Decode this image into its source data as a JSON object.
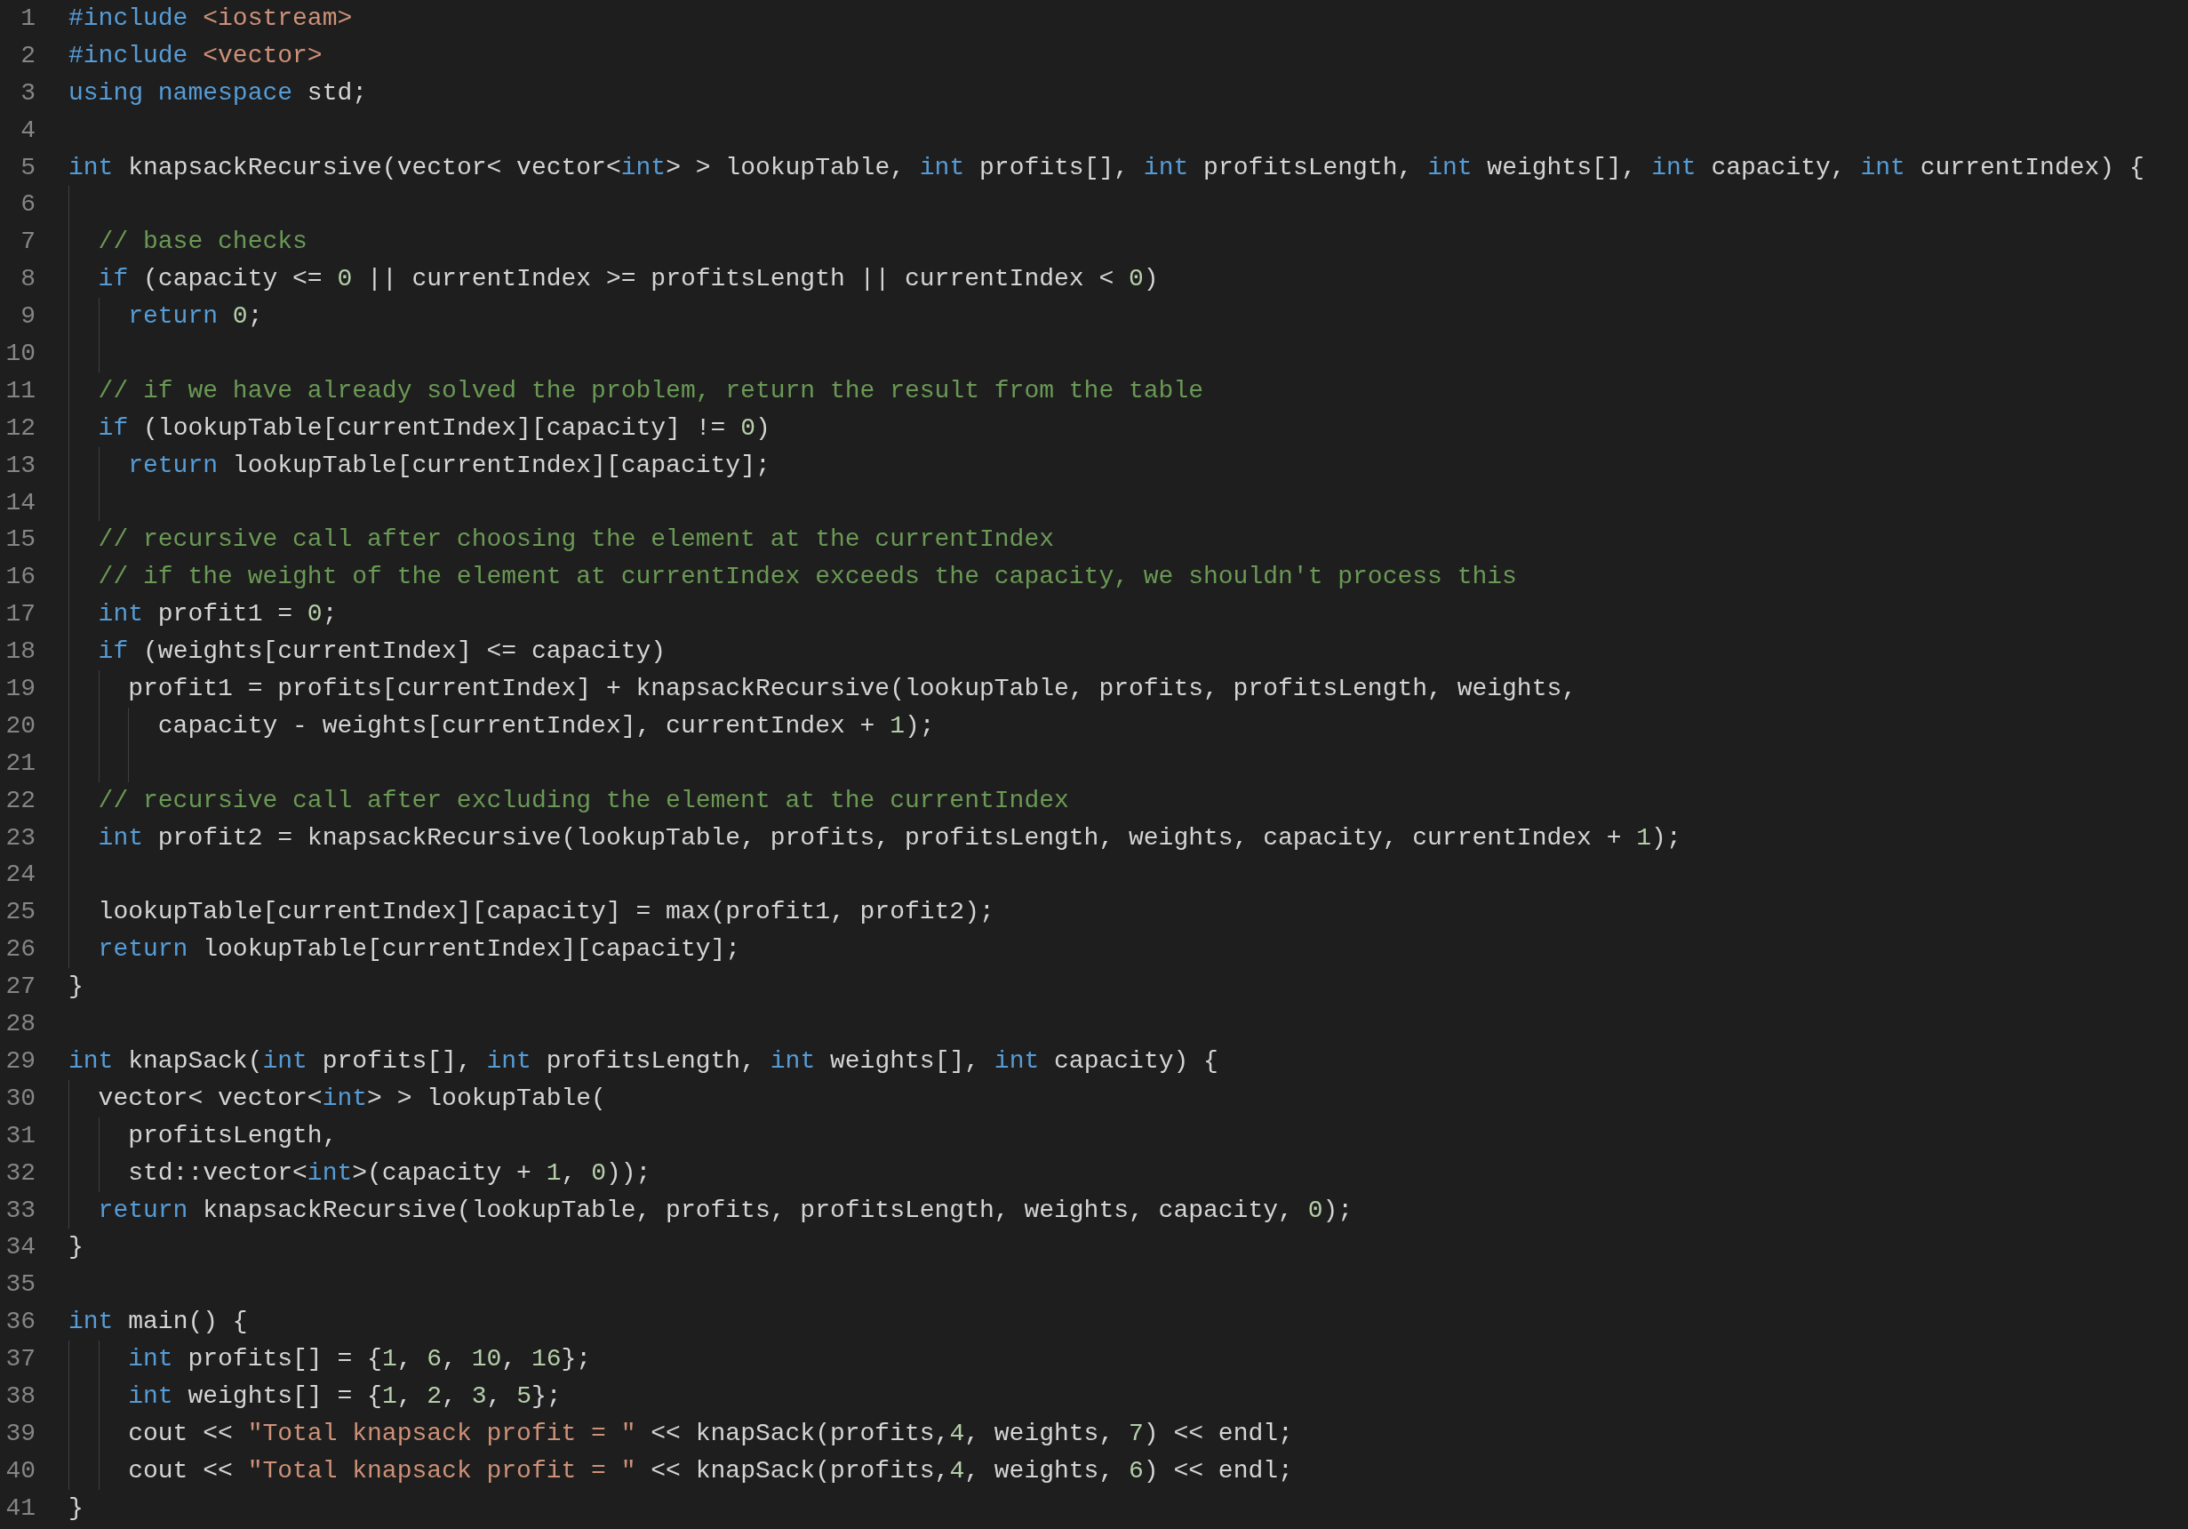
{
  "editor": {
    "lines": [
      {
        "number": "1",
        "tokens": [
          {
            "kind": "keyword",
            "text": "#include "
          },
          {
            "kind": "string",
            "text": "<iostream>"
          }
        ]
      },
      {
        "number": "2",
        "tokens": [
          {
            "kind": "keyword",
            "text": "#include "
          },
          {
            "kind": "string",
            "text": "<vector>"
          }
        ]
      },
      {
        "number": "3",
        "tokens": [
          {
            "kind": "keyword",
            "text": "using namespace"
          },
          {
            "kind": "plain",
            "text": " std;"
          }
        ]
      },
      {
        "number": "4"
      },
      {
        "number": "5",
        "tokens": [
          {
            "kind": "keyword",
            "text": "int"
          },
          {
            "kind": "plain",
            "text": " knapsackRecursive(vector< vector<"
          },
          {
            "kind": "keyword",
            "text": "int"
          },
          {
            "kind": "plain",
            "text": "> > lookupTable, "
          },
          {
            "kind": "keyword",
            "text": "int"
          },
          {
            "kind": "plain",
            "text": " profits[], "
          },
          {
            "kind": "keyword",
            "text": "int"
          },
          {
            "kind": "plain",
            "text": " profitsLength, "
          },
          {
            "kind": "keyword",
            "text": "int"
          },
          {
            "kind": "plain",
            "text": " weights[], "
          },
          {
            "kind": "keyword",
            "text": "int"
          },
          {
            "kind": "plain",
            "text": " capacity, "
          },
          {
            "kind": "keyword",
            "text": "int"
          },
          {
            "kind": "plain",
            "text": " currentIndex) {"
          }
        ]
      },
      {
        "number": "6"
      },
      {
        "number": "7",
        "tokens": [
          {
            "kind": "comment",
            "text": "  // base checks"
          }
        ]
      },
      {
        "number": "8",
        "tokens": [
          {
            "kind": "keyword",
            "text": "  if"
          },
          {
            "kind": "plain",
            "text": " (capacity <= "
          },
          {
            "kind": "number",
            "text": "0"
          },
          {
            "kind": "plain",
            "text": " || currentIndex >= profitsLength || currentIndex < "
          },
          {
            "kind": "number",
            "text": "0"
          },
          {
            "kind": "plain",
            "text": ")"
          }
        ]
      },
      {
        "number": "9",
        "tokens": [
          {
            "kind": "keyword",
            "text": "    return "
          },
          {
            "kind": "number",
            "text": "0"
          },
          {
            "kind": "plain",
            "text": ";"
          }
        ]
      },
      {
        "number": "10"
      },
      {
        "number": "11",
        "tokens": [
          {
            "kind": "comment",
            "text": "  // if we have already solved the problem, return the result from the table"
          }
        ]
      },
      {
        "number": "12",
        "tokens": [
          {
            "kind": "keyword",
            "text": "  if"
          },
          {
            "kind": "plain",
            "text": " (lookupTable[currentIndex][capacity] != "
          },
          {
            "kind": "number",
            "text": "0"
          },
          {
            "kind": "plain",
            "text": ")"
          }
        ]
      },
      {
        "number": "13",
        "tokens": [
          {
            "kind": "keyword",
            "text": "    return"
          },
          {
            "kind": "plain",
            "text": " lookupTable[currentIndex][capacity];"
          }
        ]
      },
      {
        "number": "14"
      },
      {
        "number": "15",
        "tokens": [
          {
            "kind": "comment",
            "text": "  // recursive call after choosing the element at the currentIndex"
          }
        ]
      },
      {
        "number": "16",
        "tokens": [
          {
            "kind": "comment",
            "text": "  // if the weight of the element at currentIndex exceeds the capacity, we shouldn't process this"
          }
        ]
      },
      {
        "number": "17",
        "tokens": [
          {
            "kind": "keyword",
            "text": "  int"
          },
          {
            "kind": "plain",
            "text": " profit1 = "
          },
          {
            "kind": "number",
            "text": "0"
          },
          {
            "kind": "plain",
            "text": ";"
          }
        ]
      },
      {
        "number": "18",
        "tokens": [
          {
            "kind": "keyword",
            "text": "  if"
          },
          {
            "kind": "plain",
            "text": " (weights[currentIndex] <= capacity)"
          }
        ]
      },
      {
        "number": "19",
        "tokens": [
          {
            "kind": "plain",
            "text": "    profit1 = profits[currentIndex] + knapsackRecursive(lookupTable, profits, profitsLength, weights,"
          }
        ]
      },
      {
        "number": "20",
        "tokens": [
          {
            "kind": "plain",
            "text": "      capacity - weights[currentIndex], currentIndex + "
          },
          {
            "kind": "number",
            "text": "1"
          },
          {
            "kind": "plain",
            "text": ");"
          }
        ]
      },
      {
        "number": "21"
      },
      {
        "number": "22",
        "tokens": [
          {
            "kind": "comment",
            "text": "  // recursive call after excluding the element at the currentIndex"
          }
        ]
      },
      {
        "number": "23",
        "tokens": [
          {
            "kind": "keyword",
            "text": "  int"
          },
          {
            "kind": "plain",
            "text": " profit2 = knapsackRecursive(lookupTable, profits, profitsLength, weights, capacity, currentIndex + "
          },
          {
            "kind": "number",
            "text": "1"
          },
          {
            "kind": "plain",
            "text": ");"
          }
        ]
      },
      {
        "number": "24"
      },
      {
        "number": "25",
        "tokens": [
          {
            "kind": "plain",
            "text": "  lookupTable[currentIndex][capacity] = max(profit1, profit2);"
          }
        ]
      },
      {
        "number": "26",
        "tokens": [
          {
            "kind": "keyword",
            "text": "  return"
          },
          {
            "kind": "plain",
            "text": " lookupTable[currentIndex][capacity];"
          }
        ]
      },
      {
        "number": "27",
        "tokens": [
          {
            "kind": "plain",
            "text": "}"
          }
        ]
      },
      {
        "number": "28"
      },
      {
        "number": "29",
        "tokens": [
          {
            "kind": "keyword",
            "text": "int"
          },
          {
            "kind": "plain",
            "text": " knapSack("
          },
          {
            "kind": "keyword",
            "text": "int"
          },
          {
            "kind": "plain",
            "text": " profits[], "
          },
          {
            "kind": "keyword",
            "text": "int"
          },
          {
            "kind": "plain",
            "text": " profitsLength, "
          },
          {
            "kind": "keyword",
            "text": "int"
          },
          {
            "kind": "plain",
            "text": " weights[], "
          },
          {
            "kind": "keyword",
            "text": "int"
          },
          {
            "kind": "plain",
            "text": " capacity) {"
          }
        ]
      },
      {
        "number": "30",
        "tokens": [
          {
            "kind": "plain",
            "text": "  vector< vector<"
          },
          {
            "kind": "keyword",
            "text": "int"
          },
          {
            "kind": "plain",
            "text": "> > lookupTable("
          }
        ]
      },
      {
        "number": "31",
        "tokens": [
          {
            "kind": "plain",
            "text": "    profitsLength,"
          }
        ]
      },
      {
        "number": "32",
        "tokens": [
          {
            "kind": "plain",
            "text": "    std::vector<"
          },
          {
            "kind": "keyword",
            "text": "int"
          },
          {
            "kind": "plain",
            "text": ">(capacity + "
          },
          {
            "kind": "number",
            "text": "1"
          },
          {
            "kind": "plain",
            "text": ", "
          },
          {
            "kind": "number",
            "text": "0"
          },
          {
            "kind": "plain",
            "text": "));"
          }
        ]
      },
      {
        "number": "33",
        "tokens": [
          {
            "kind": "keyword",
            "text": "  return"
          },
          {
            "kind": "plain",
            "text": " knapsackRecursive(lookupTable, profits, profitsLength, weights, capacity, "
          },
          {
            "kind": "number",
            "text": "0"
          },
          {
            "kind": "plain",
            "text": ");"
          }
        ]
      },
      {
        "number": "34",
        "tokens": [
          {
            "kind": "plain",
            "text": "}"
          }
        ]
      },
      {
        "number": "35"
      },
      {
        "number": "36",
        "tokens": [
          {
            "kind": "keyword",
            "text": "int"
          },
          {
            "kind": "plain",
            "text": " main() {"
          }
        ]
      },
      {
        "number": "37",
        "tokens": [
          {
            "kind": "keyword",
            "text": "    int"
          },
          {
            "kind": "plain",
            "text": " profits[] = {"
          },
          {
            "kind": "number",
            "text": "1"
          },
          {
            "kind": "plain",
            "text": ", "
          },
          {
            "kind": "number",
            "text": "6"
          },
          {
            "kind": "plain",
            "text": ", "
          },
          {
            "kind": "number",
            "text": "10"
          },
          {
            "kind": "plain",
            "text": ", "
          },
          {
            "kind": "number",
            "text": "16"
          },
          {
            "kind": "plain",
            "text": "};"
          }
        ]
      },
      {
        "number": "38",
        "tokens": [
          {
            "kind": "keyword",
            "text": "    int"
          },
          {
            "kind": "plain",
            "text": " weights[] = {"
          },
          {
            "kind": "number",
            "text": "1"
          },
          {
            "kind": "plain",
            "text": ", "
          },
          {
            "kind": "number",
            "text": "2"
          },
          {
            "kind": "plain",
            "text": ", "
          },
          {
            "kind": "number",
            "text": "3"
          },
          {
            "kind": "plain",
            "text": ", "
          },
          {
            "kind": "number",
            "text": "5"
          },
          {
            "kind": "plain",
            "text": "};"
          }
        ]
      },
      {
        "number": "39",
        "tokens": [
          {
            "kind": "plain",
            "text": "    cout << "
          },
          {
            "kind": "string",
            "text": "\"Total knapsack profit = \""
          },
          {
            "kind": "plain",
            "text": " << knapSack(profits,"
          },
          {
            "kind": "number",
            "text": "4"
          },
          {
            "kind": "plain",
            "text": ", weights, "
          },
          {
            "kind": "number",
            "text": "7"
          },
          {
            "kind": "plain",
            "text": ") << endl;"
          }
        ]
      },
      {
        "number": "40",
        "tokens": [
          {
            "kind": "plain",
            "text": "    cout << "
          },
          {
            "kind": "string",
            "text": "\"Total knapsack profit = \""
          },
          {
            "kind": "plain",
            "text": " << knapSack(profits,"
          },
          {
            "kind": "number",
            "text": "4"
          },
          {
            "kind": "plain",
            "text": ", weights, "
          },
          {
            "kind": "number",
            "text": "6"
          },
          {
            "kind": "plain",
            "text": ") << endl;"
          }
        ]
      },
      {
        "number": "41",
        "tokens": [
          {
            "kind": "plain",
            "text": "}"
          }
        ]
      }
    ]
  }
}
